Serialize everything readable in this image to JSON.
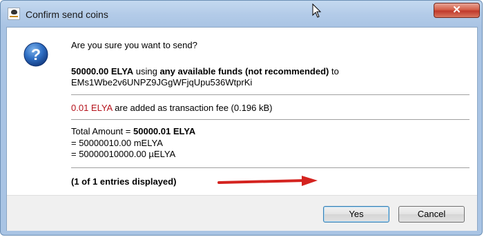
{
  "window": {
    "title": "Confirm send coins",
    "close_label": "✕"
  },
  "dialog": {
    "question": "Are you sure you want to send?",
    "amount": "50000.00 ELYA",
    "using_word": "using",
    "funds_source": "any available funds (not recommended)",
    "to_word": "to",
    "address": "EMs1Wbe2v6UNPZ9JGgWFjqUpu536WtprKi",
    "fee_amount": "0.01 ELYA",
    "fee_text": "are added as transaction fee (0.196 kB)",
    "total_label": "Total Amount =",
    "total_value": "50000.01 ELYA",
    "total_milli": "= 50000010.00 mELYA",
    "total_micro": "= 50000010000.00 µELYA",
    "entries_note": "(1 of 1 entries displayed)"
  },
  "buttons": {
    "yes_label": "Yes",
    "cancel_label": "Cancel"
  },
  "colors": {
    "fee_red": "#b5121b",
    "arrow_red": "#d4231f",
    "titlebar_blue": "#b3cbe8"
  },
  "icons": {
    "app": "elysium-app-icon",
    "question": "question-icon",
    "close": "close-icon",
    "cursor": "mouse-cursor-icon",
    "annotation_arrow": "red-arrow-annotation"
  }
}
